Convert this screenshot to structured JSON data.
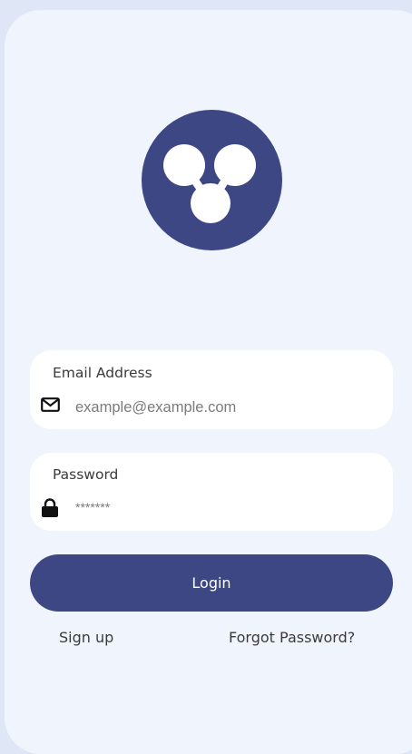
{
  "form": {
    "email_label": "Email Address",
    "email_placeholder": "example@example.com",
    "email_value": "",
    "password_label": "Password",
    "password_placeholder": "*******",
    "password_value": ""
  },
  "actions": {
    "login_label": "Login",
    "signup_label": "Sign up",
    "forgot_label": "Forgot Password?"
  },
  "icons": {
    "logo": "molecule-logo-icon",
    "email": "envelope-icon",
    "password": "lock-icon"
  },
  "colors": {
    "accent": "#3d4784",
    "background": "#dfe6f5",
    "card": "#f0f5fd",
    "field": "#ffffff"
  }
}
